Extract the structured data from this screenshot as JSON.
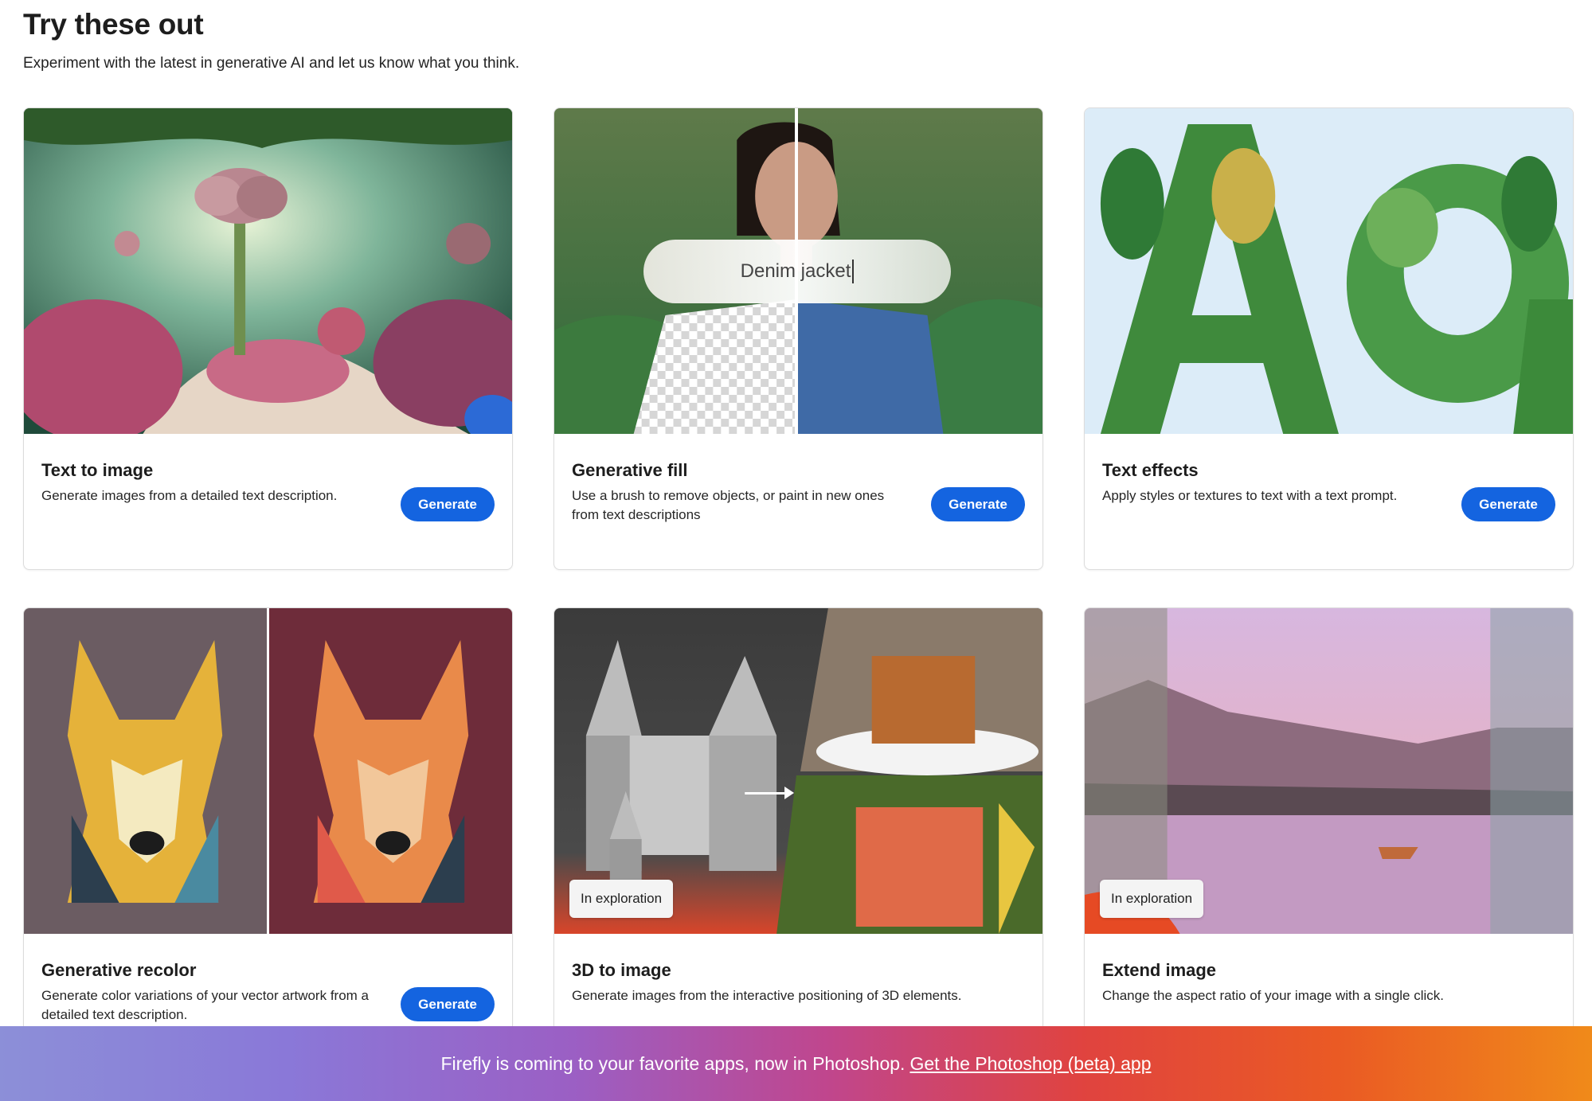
{
  "header": {
    "title": "Try these out",
    "subtitle": "Experiment with the latest in generative AI and let us know what you think."
  },
  "cards": [
    {
      "title": "Text to image",
      "description": "Generate images from a detailed text description.",
      "button": "Generate",
      "image_icon": "fantasy-garden-image"
    },
    {
      "title": "Generative fill",
      "description": "Use a brush to remove objects, or paint in new ones from text descriptions",
      "button": "Generate",
      "image_icon": "portrait-fill-image",
      "prompt_text": "Denim jacket"
    },
    {
      "title": "Text effects",
      "description": "Apply styles or textures to text with a text prompt.",
      "button": "Generate",
      "image_icon": "leaf-letters-image"
    },
    {
      "title": "Generative recolor",
      "description": "Generate color variations of your vector artwork from a detailed text description.",
      "button": "Generate",
      "image_icon": "dog-recolor-image"
    },
    {
      "title": "3D to image",
      "description": "Generate images from the interactive positioning of 3D elements.",
      "badge": "In exploration",
      "image_icon": "castle-3d-image"
    },
    {
      "title": "Extend image",
      "description": "Change the aspect ratio of your image with a single click.",
      "badge": "In exploration",
      "image_icon": "lake-landscape-image"
    }
  ],
  "banner": {
    "text": "Firefly is coming to your favorite apps, now in Photoshop.",
    "link": "Get the Photoshop (beta) app"
  },
  "colors": {
    "accent": "#1464e0",
    "banner_gradient": [
      "#8c8fd8",
      "#9b5fc4",
      "#e0433f",
      "#f08a1a"
    ]
  }
}
